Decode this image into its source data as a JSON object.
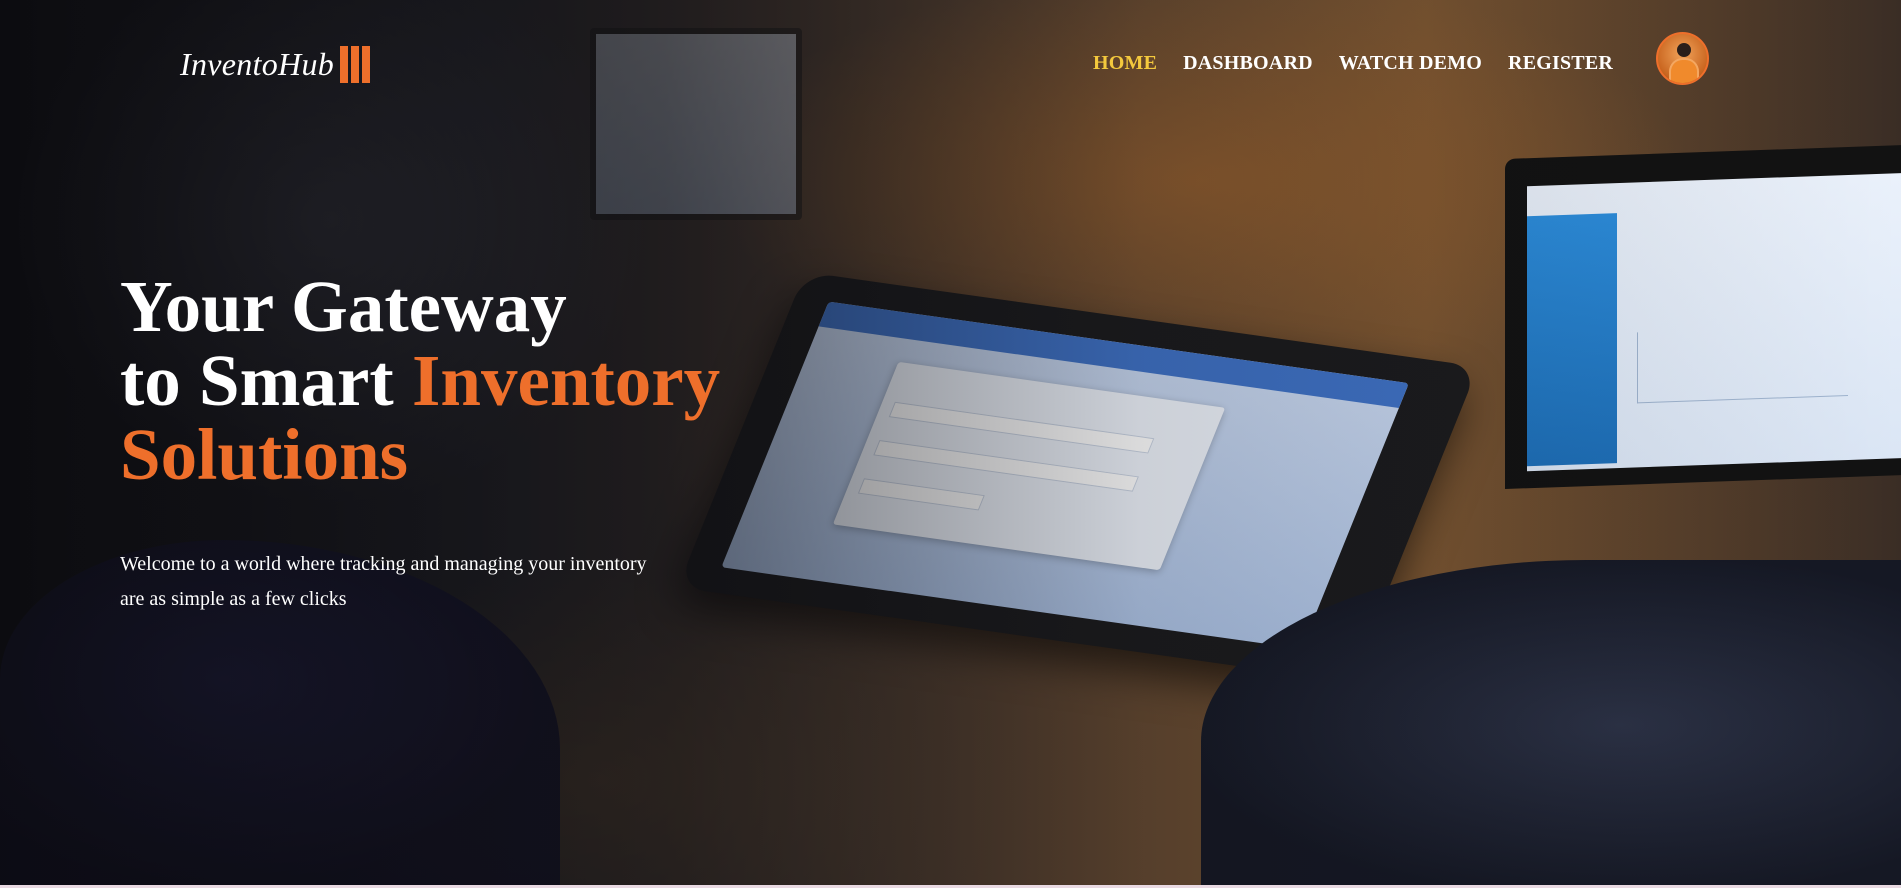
{
  "brand": {
    "name": "InventoHub",
    "accent_color": "#ee6f2b",
    "active_nav_color": "#f4c93d"
  },
  "nav": {
    "items": [
      {
        "label": "HOME",
        "active": true
      },
      {
        "label": "DASHBOARD",
        "active": false
      },
      {
        "label": "WATCH DEMO",
        "active": false
      },
      {
        "label": "REGISTER",
        "active": false
      }
    ]
  },
  "user": {
    "avatar_icon": "user-avatar-icon"
  },
  "hero": {
    "headline_line1": "Your Gateway",
    "headline_line2_prefix": "to Smart ",
    "headline_line2_accent": "Inventory",
    "headline_line3_accent": "Solutions",
    "subtext_line1": "Welcome to a world where tracking and managing your inventory",
    "subtext_line2": "are as simple as a few clicks"
  }
}
